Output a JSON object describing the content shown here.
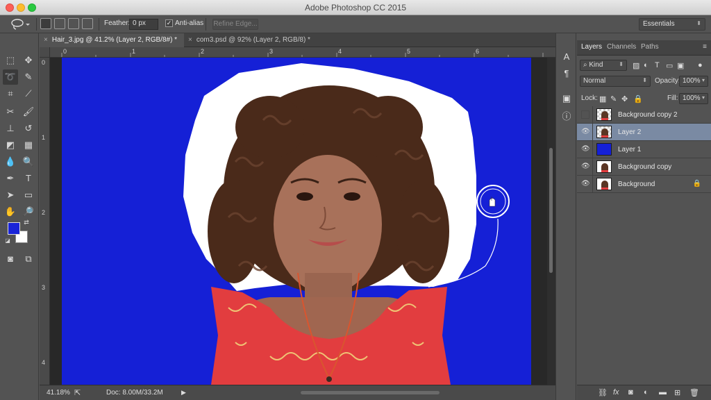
{
  "window": {
    "title": "Adobe Photoshop CC 2015"
  },
  "options_bar": {
    "feather_label": "Feather:",
    "feather_value": "0 px",
    "anti_alias_label": "Anti-alias",
    "anti_alias_checked": true,
    "anti_alias_mark": "✓",
    "refine_edge_label": "Refine Edge...",
    "workspace": "Essentials"
  },
  "tabs": [
    {
      "label": "Hair_3.jpg @ 41.2% (Layer 2, RGB/8#) *",
      "active": true
    },
    {
      "label": "com3.psd @ 92% (Layer 2, RGB/8) *",
      "active": false
    }
  ],
  "rulers": {
    "horizontal": [
      "0",
      "1",
      "2",
      "3",
      "4",
      "5",
      "6"
    ],
    "vertical": [
      "0",
      "1",
      "2",
      "3",
      "4"
    ]
  },
  "status_bar": {
    "zoom": "41.18%",
    "doc": "Doc: 8.00M/33.2M"
  },
  "layers_panel": {
    "tabs": [
      "Layers",
      "Channels",
      "Paths"
    ],
    "filter_kind": "Kind",
    "blend_mode": "Normal",
    "opacity_label": "Opacity:",
    "opacity_value": "100%",
    "lock_label": "Lock:",
    "fill_label": "Fill:",
    "fill_value": "100%",
    "layers": [
      {
        "name": "Background copy 2",
        "visible": false,
        "selected": false,
        "thumb": "checker-girl",
        "locked": false
      },
      {
        "name": "Layer 2",
        "visible": true,
        "selected": true,
        "thumb": "checker-girl",
        "locked": false
      },
      {
        "name": "Layer 1",
        "visible": true,
        "selected": false,
        "thumb": "blue",
        "locked": false
      },
      {
        "name": "Background copy",
        "visible": true,
        "selected": false,
        "thumb": "white-girl",
        "locked": false
      },
      {
        "name": "Background",
        "visible": true,
        "selected": false,
        "thumb": "white-girl",
        "locked": true
      }
    ]
  },
  "colors": {
    "foreground": "#1924d8",
    "background": "#ffffff",
    "canvas_fill": "#1520d6",
    "selected_layer": "#7a8aa3"
  },
  "icons": {
    "lasso": "lasso-icon",
    "eye": "eye-icon"
  }
}
